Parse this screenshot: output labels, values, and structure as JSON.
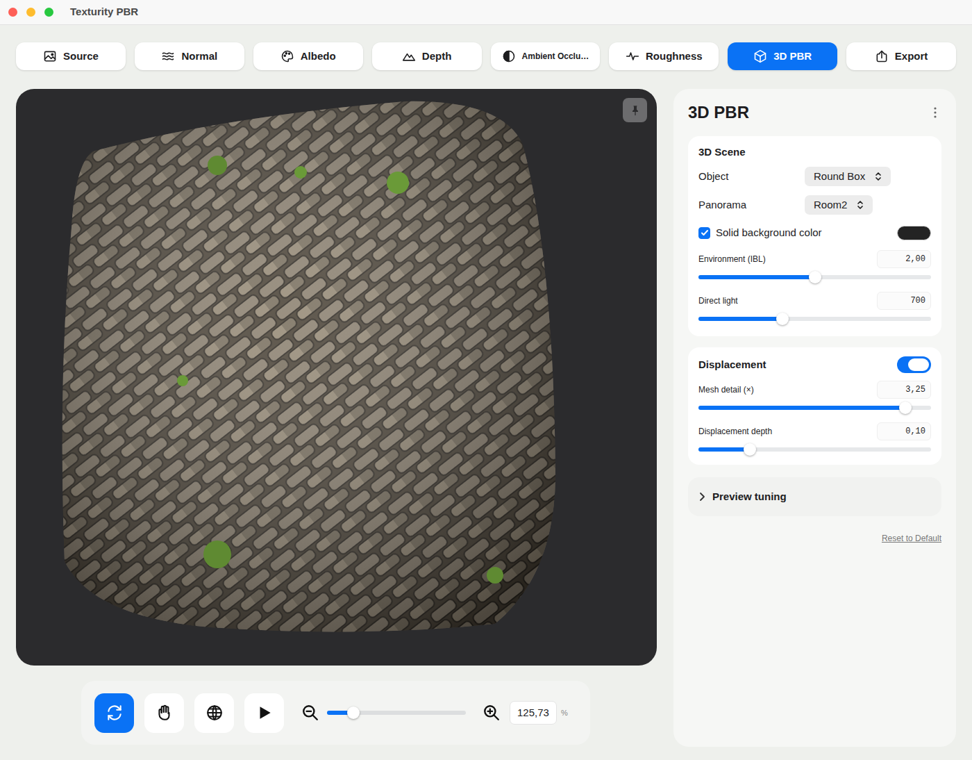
{
  "window": {
    "title": "Texturity PBR"
  },
  "tabs": [
    {
      "label": "Source",
      "selected": false
    },
    {
      "label": "Normal",
      "selected": false
    },
    {
      "label": "Albedo",
      "selected": false
    },
    {
      "label": "Depth",
      "selected": false
    },
    {
      "label": "Ambient Occlu…",
      "selected": false
    },
    {
      "label": "Roughness",
      "selected": false
    },
    {
      "label": "3D PBR",
      "selected": true
    },
    {
      "label": "Export",
      "selected": false
    }
  ],
  "toolbar": {
    "tools": [
      {
        "selected": true
      },
      {
        "selected": false
      },
      {
        "selected": false
      },
      {
        "selected": false
      }
    ],
    "zoom": {
      "level": 0.19,
      "value": "125,73",
      "unit": "%"
    }
  },
  "panel": {
    "title": "3D PBR"
  },
  "scene": {
    "title": "3D Scene",
    "rows": [
      {
        "kind": "select",
        "label": "Object",
        "value": "Round Box"
      },
      {
        "kind": "select",
        "label": "Panorama",
        "value": "Room2"
      },
      {
        "kind": "checkbox",
        "label": "Solid background color",
        "checked": true,
        "color": "#232323"
      },
      {
        "kind": "slider",
        "label": "Environment (IBL)",
        "value": "2,00",
        "level": 0.5
      },
      {
        "kind": "slider",
        "label": "Direct light",
        "value": "700",
        "level": 0.36
      }
    ]
  },
  "displacement": {
    "title": "Displacement",
    "on": true,
    "rows": [
      {
        "kind": "slider",
        "label": "Mesh detail (×)",
        "value": "3,25",
        "level": 0.89
      },
      {
        "kind": "slider",
        "label": "Displacement depth",
        "value": "0,10",
        "level": 0.22
      }
    ]
  },
  "preview_tuning": {
    "title": "Preview tuning",
    "expanded": false
  },
  "reset": "Reset to Default"
}
